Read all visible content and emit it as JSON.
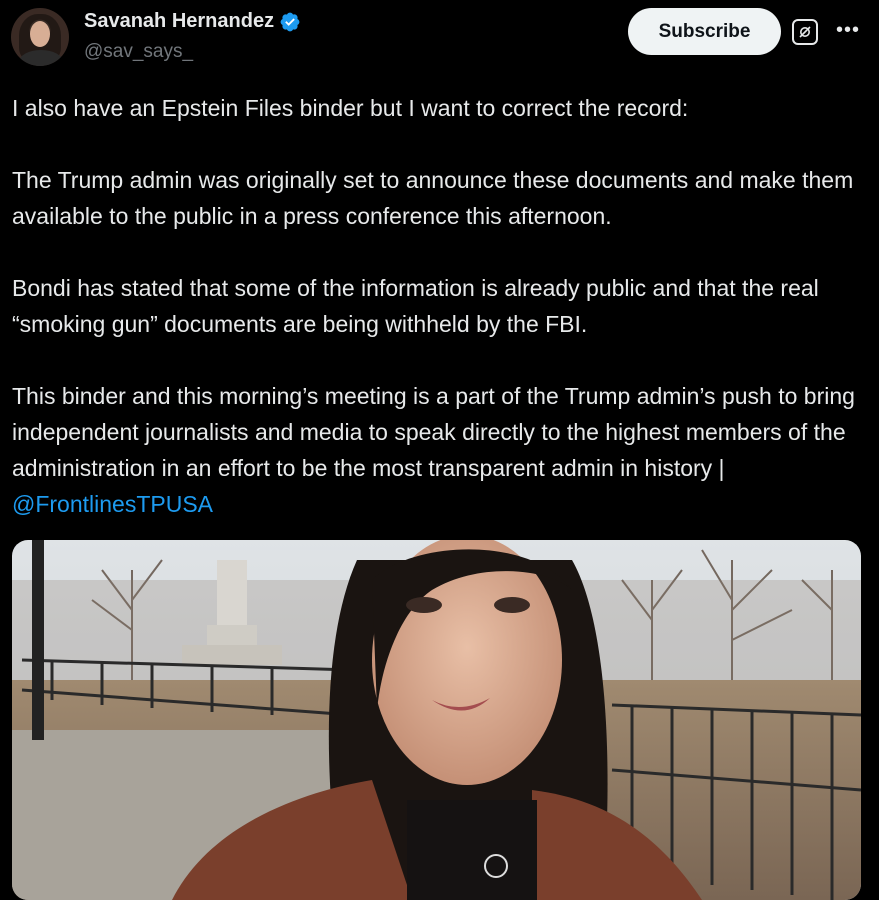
{
  "author": {
    "display_name": "Savanah Hernandez",
    "handle": "@sav_says_"
  },
  "actions": {
    "subscribe_label": "Subscribe",
    "grok_icon": "grok-icon",
    "more_icon": "more-horizontal-icon"
  },
  "colors": {
    "background": "#000000",
    "text": "#e7e9ea",
    "secondary_text": "#71767b",
    "link": "#1d9bf0",
    "verified": "#1d9bf0"
  },
  "tweet": {
    "paragraph_1": "I also have an Epstein Files binder but I want to correct the record:",
    "paragraph_2": "The Trump admin was originally set to announce these documents and make them available to the public in a press conference this afternoon.",
    "paragraph_3": "Bondi has stated that some of the information is already public and that the real “smoking gun” documents are being withheld by the FBI.",
    "paragraph_4": "This binder and this morning’s meeting is a part of the Trump admin’s push to bring independent journalists and media to speak directly to the highest members of the administration in an effort to be the most transparent admin in history | ",
    "mention": "@FrontlinesTPUSA"
  }
}
